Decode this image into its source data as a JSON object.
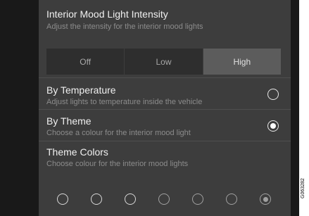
{
  "intensity": {
    "title": "Interior Mood Light Intensity",
    "subtitle": "Adjust the intensity for the interior mood lights",
    "options": [
      {
        "label": "Off",
        "selected": false
      },
      {
        "label": "Low",
        "selected": false
      },
      {
        "label": "High",
        "selected": true
      }
    ]
  },
  "by_temperature": {
    "title": "By Temperature",
    "subtitle": "Adjust lights to temperature inside the vehicle",
    "checked": false
  },
  "by_theme": {
    "title": "By Theme",
    "subtitle": "Choose a colour for the interior mood light",
    "checked": true
  },
  "theme_colors": {
    "title": "Theme Colors",
    "subtitle": "Choose colour for the interior mood lights",
    "swatch_count": 7,
    "dimmed_from_index": 3,
    "selected_index": 6
  },
  "image_code": "G063282",
  "colors": {
    "background": "#191919",
    "panel": "#3d3d3d",
    "selected_segment": "#5c5c5c",
    "text_primary": "#f0f0f0",
    "text_secondary": "#8c8c8c"
  }
}
